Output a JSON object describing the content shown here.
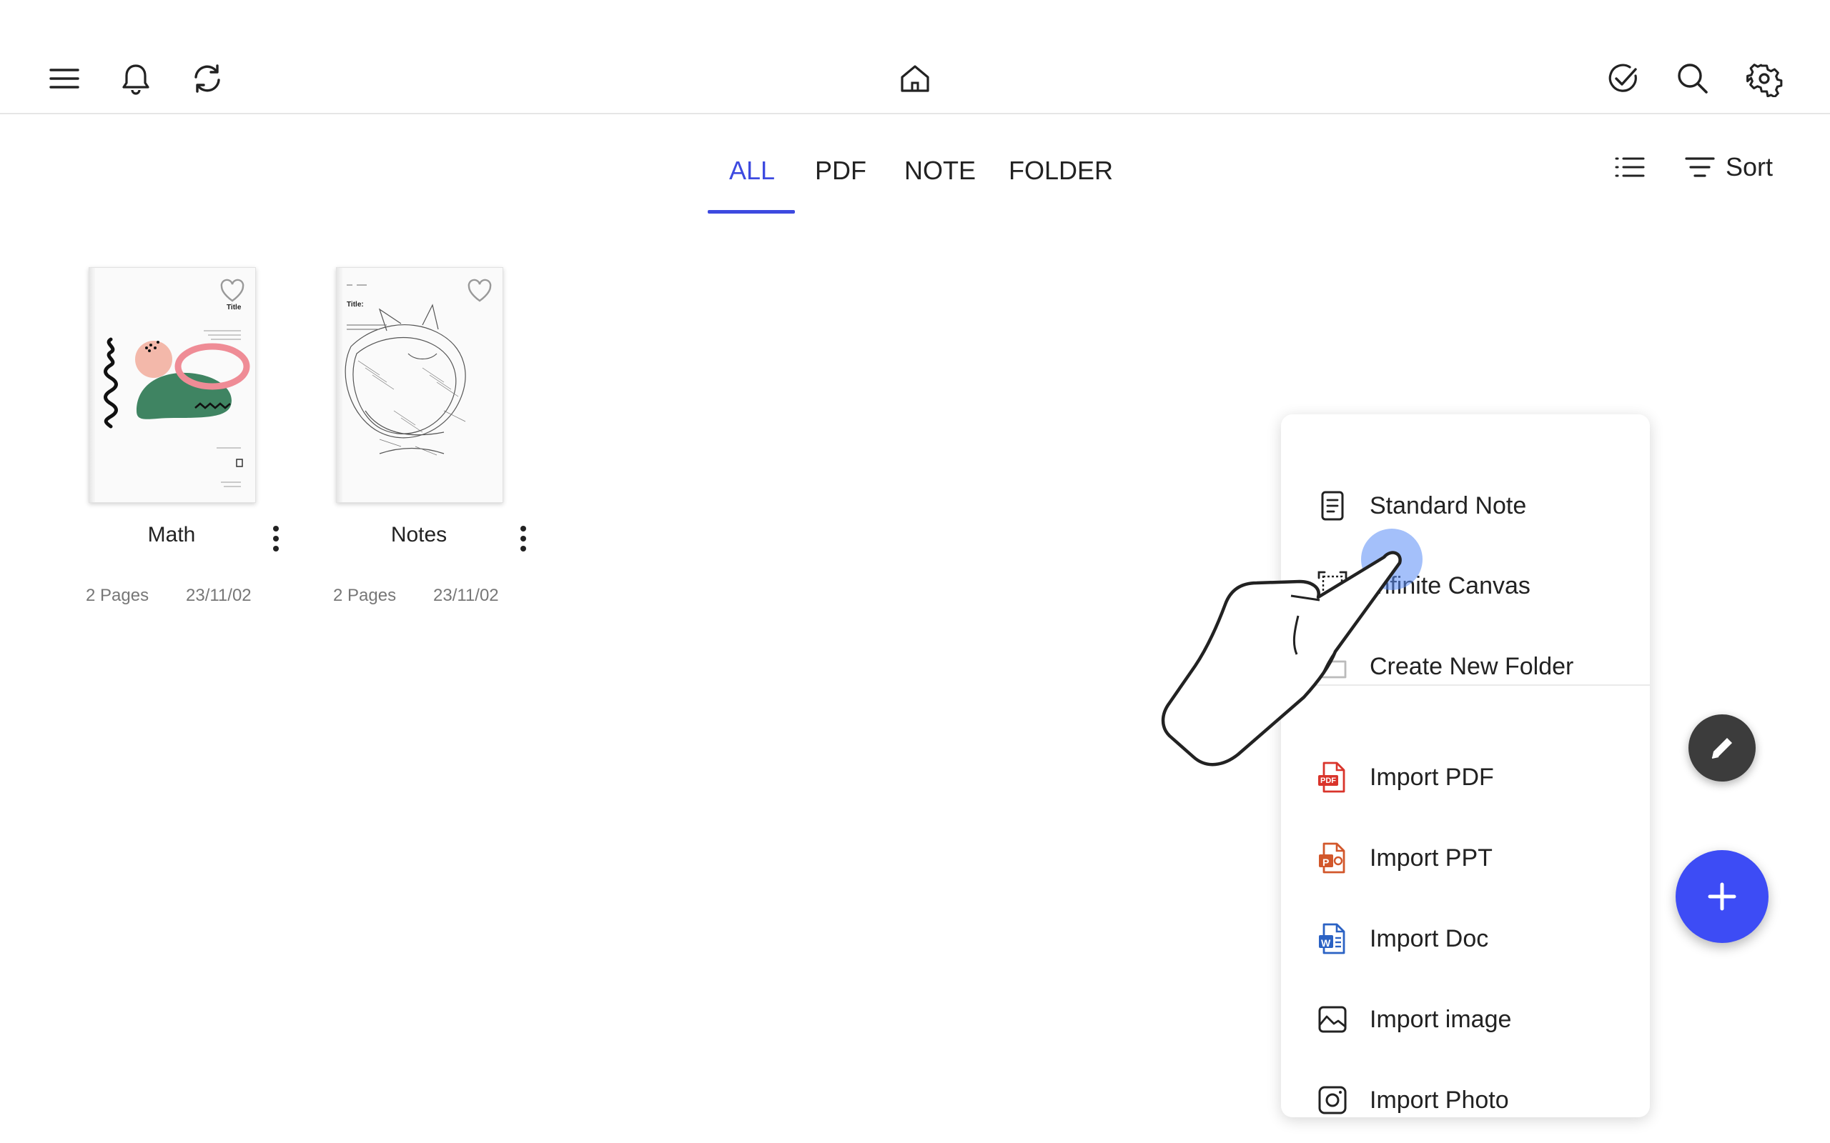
{
  "topbar": {
    "left_icons": [
      "menu-icon",
      "bell-icon",
      "sync-icon"
    ],
    "center_icon": "home-icon",
    "right_icons": [
      "check-circle-icon",
      "search-icon",
      "settings-icon"
    ]
  },
  "tabs": [
    {
      "label": "ALL",
      "active": true
    },
    {
      "label": "PDF",
      "active": false
    },
    {
      "label": "NOTE",
      "active": false
    },
    {
      "label": "FOLDER",
      "active": false
    }
  ],
  "toolbar": {
    "view_icon": "list-view-icon",
    "sort_label": "Sort"
  },
  "files": [
    {
      "title": "Math",
      "pages": "2 Pages",
      "date": "23/11/02",
      "cover_text": "Title"
    },
    {
      "title": "Notes",
      "pages": "2 Pages",
      "date": "23/11/02",
      "cover_text": "Title:"
    }
  ],
  "new_menu": {
    "items": [
      {
        "label": "Standard Note",
        "icon": "document-icon"
      },
      {
        "label": "Infinite Canvas",
        "icon": "canvas-expand-icon"
      },
      {
        "label": "Create New Folder",
        "icon": "folder-icon"
      },
      {
        "label": "Import PDF",
        "icon": "pdf-file-icon"
      },
      {
        "label": "Import PPT",
        "icon": "ppt-file-icon"
      },
      {
        "label": "Import Doc",
        "icon": "word-file-icon"
      },
      {
        "label": "Import image",
        "icon": "image-icon"
      },
      {
        "label": "Import Photo",
        "icon": "camera-icon"
      }
    ],
    "file_badges": {
      "pdf": "PDF",
      "ppt": "P",
      "doc": "W"
    }
  },
  "colors": {
    "accent": "#3d4ae0",
    "fab": "#3d4cf5",
    "pdf": "#d9342b",
    "ppt": "#d2572b",
    "doc": "#2b62c4"
  }
}
